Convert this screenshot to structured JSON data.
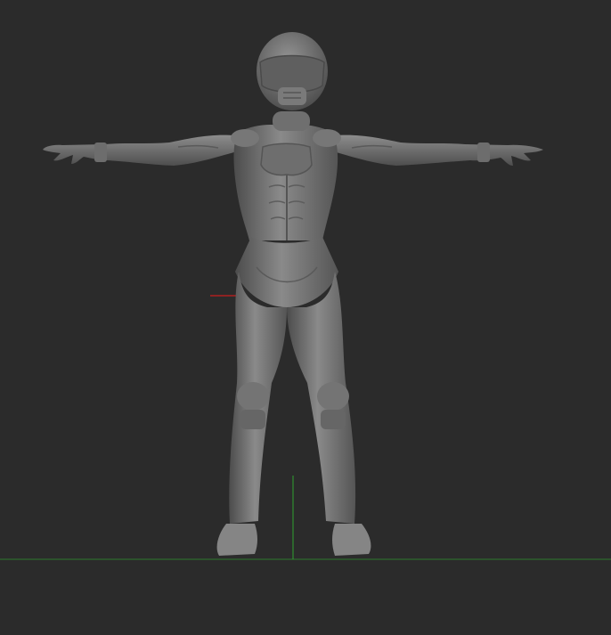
{
  "viewport": {
    "background_color": "#2b2b2b",
    "model": {
      "kind": "sculpted humanoid figure",
      "pose": "T-pose",
      "material_color": "#7a7a7a"
    },
    "axes": {
      "x_axis_color": "#b02020",
      "y_axis_color": "#2fa02f",
      "floor_line_color": "#2e7a2e"
    }
  }
}
